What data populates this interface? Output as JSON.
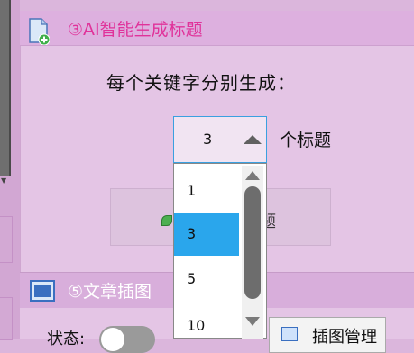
{
  "section_ai": {
    "title": "③AI智能生成标题",
    "prompt_label": "每个关键字分别生成：",
    "count_select": {
      "value": "3",
      "suffix": "个标题",
      "options": [
        "1",
        "3",
        "5",
        "10"
      ],
      "selected_index": 1
    },
    "generate_button_label_visible": "题"
  },
  "section_images": {
    "title": "⑤文章插图",
    "status_label": "状态:",
    "manage_button_label": "插图管理"
  },
  "colors": {
    "accent_pink": "#e0329a",
    "select_border": "#3aa0e0",
    "selected_option": "#2aa6ec"
  }
}
